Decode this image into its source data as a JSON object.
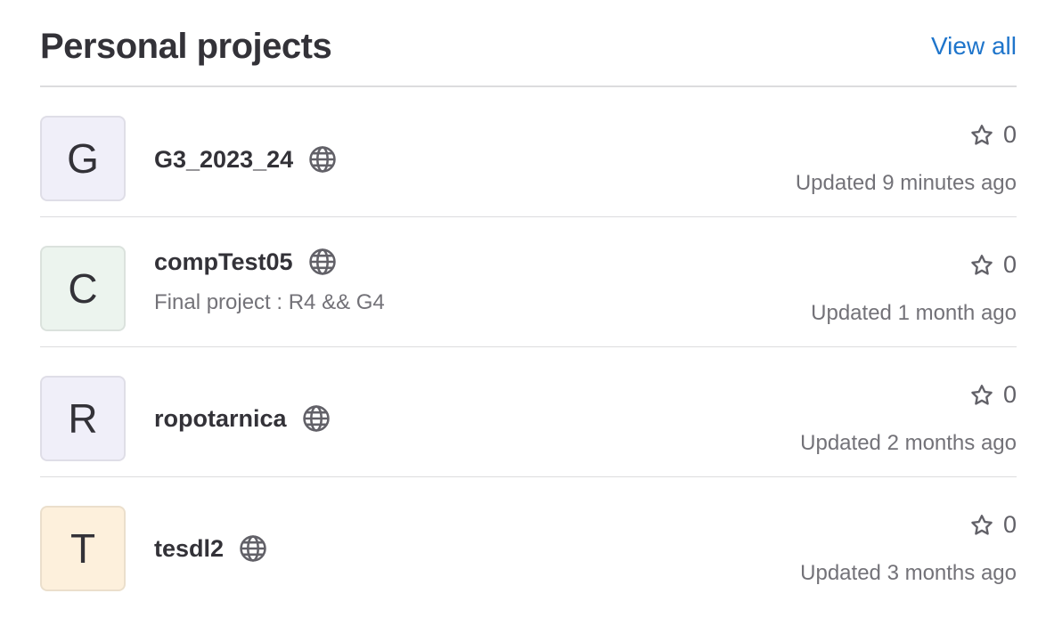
{
  "header": {
    "title": "Personal projects",
    "view_all_label": "View all"
  },
  "colors": {
    "link": "#1f75cb",
    "text": "#333238",
    "muted": "#737278",
    "divider": "#dcdcde"
  },
  "projects": [
    {
      "initial": "G",
      "name": "G3_2023_24",
      "description": "",
      "visibility_icon": "globe-icon",
      "stars": "0",
      "updated": "Updated 9 minutes ago",
      "avatar_color": "#f0eff9"
    },
    {
      "initial": "C",
      "name": "compTest05",
      "description": "Final project : R4 && G4",
      "visibility_icon": "globe-icon",
      "stars": "0",
      "updated": "Updated 1 month ago",
      "avatar_color": "#ecf4ee"
    },
    {
      "initial": "R",
      "name": "ropotarnica",
      "description": "",
      "visibility_icon": "globe-icon",
      "stars": "0",
      "updated": "Updated 2 months ago",
      "avatar_color": "#f0eff9"
    },
    {
      "initial": "T",
      "name": "tesdl2",
      "description": "",
      "visibility_icon": "globe-icon",
      "stars": "0",
      "updated": "Updated 3 months ago",
      "avatar_color": "#fdf0dc"
    }
  ]
}
